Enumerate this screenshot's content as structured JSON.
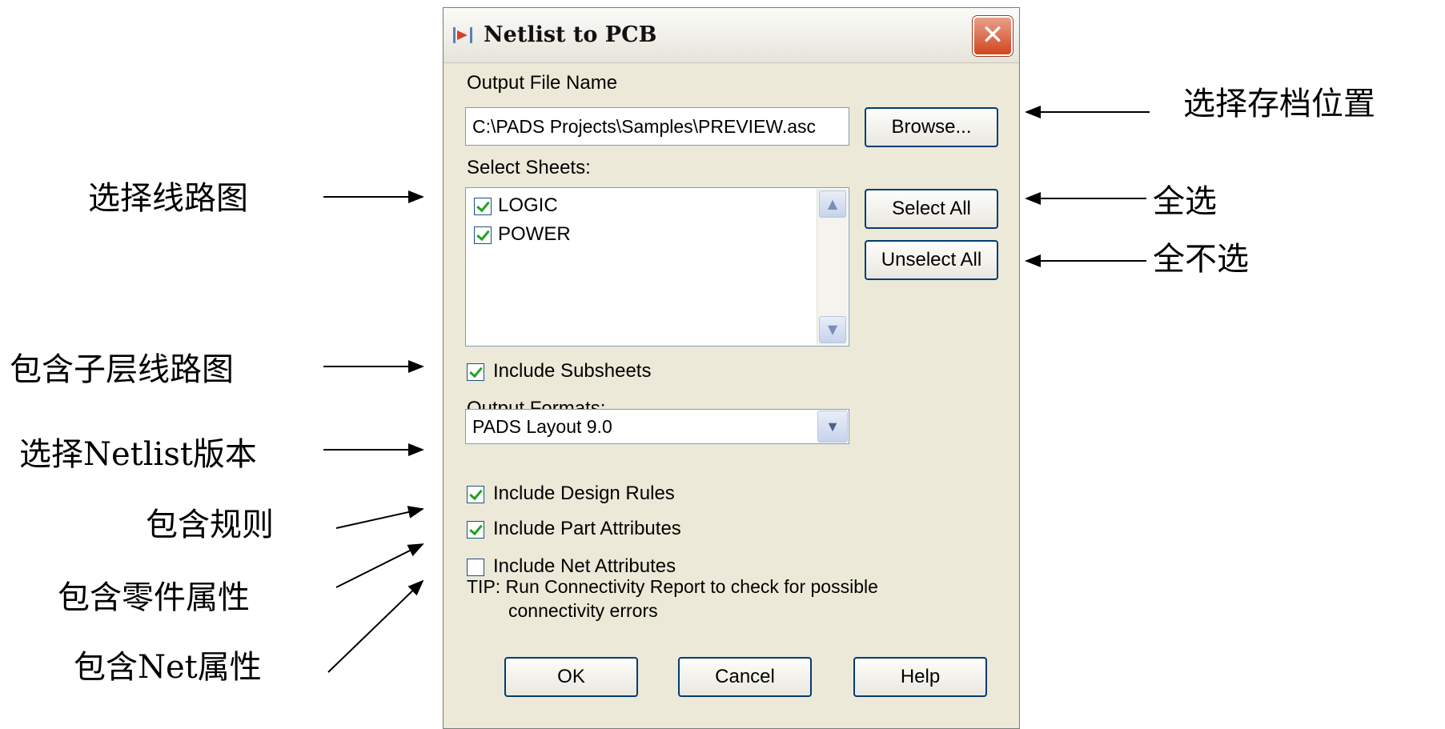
{
  "dialog": {
    "title": "Netlist to PCB",
    "close_label": "✕",
    "output_file_label": "Output File Name",
    "output_file_value": "C:\\PADS Projects\\Samples\\PREVIEW.asc",
    "browse_label": "Browse...",
    "select_sheets_label": "Select Sheets:",
    "sheets": [
      {
        "label": "LOGIC",
        "checked": true
      },
      {
        "label": "POWER",
        "checked": true
      }
    ],
    "select_all_label": "Select All",
    "unselect_all_label": "Unselect All",
    "include_subsheets_label": "Include Subsheets",
    "output_formats_label": "Output Formats:",
    "output_format_value": "PADS Layout 9.0",
    "include_design_rules_label": "Include Design Rules",
    "include_part_attributes_label": "Include Part Attributes",
    "include_net_attributes_label": "Include Net Attributes",
    "tip_line1": "TIP:  Run Connectivity Report to check for possible",
    "tip_line2": "connectivity errors",
    "ok_label": "OK",
    "cancel_label": "Cancel",
    "help_label": "Help"
  },
  "annotations": {
    "browse": "选择存档位置",
    "select_all": "全选",
    "unselect_all": "全不选",
    "select_sheets": "选择线路图",
    "subsheets": "包含子层线路图",
    "netlist_version": "选择Netlist版本",
    "design_rules": "包含规则",
    "part_attributes": "包含零件属性",
    "net_attributes": "包含Net属性"
  }
}
